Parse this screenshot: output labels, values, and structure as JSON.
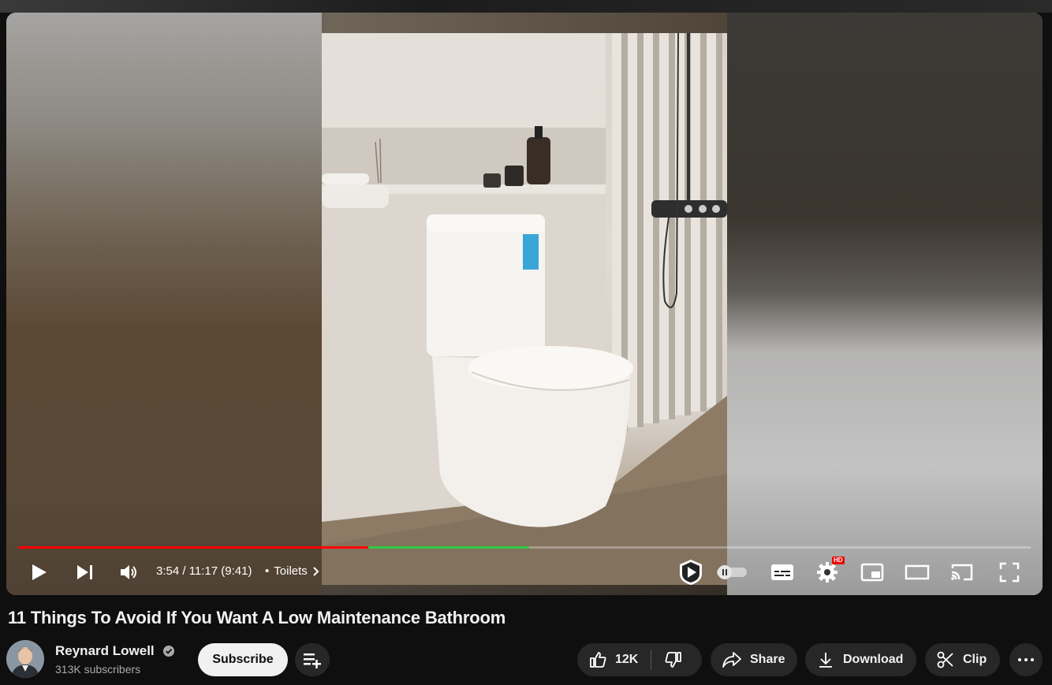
{
  "player": {
    "time_display": "3:54 / 11:17 (9:41)",
    "chapter_separator": "•",
    "chapter_title": "Toilets",
    "progress_fraction": 0.346,
    "buffered_fraction": 0.505,
    "quality_badge": "HD",
    "progress_color": "#ff0000",
    "buffer_color": "#2ecc40"
  },
  "video": {
    "title": "11 Things To Avoid If You Want A Low Maintenance Bathroom"
  },
  "channel": {
    "name": "Reynard Lowell",
    "subscribers": "313K subscribers",
    "subscribe_label": "Subscribe"
  },
  "actions": {
    "like_count": "12K",
    "share_label": "Share",
    "download_label": "Download",
    "clip_label": "Clip"
  },
  "icons": [
    "play-icon",
    "next-icon",
    "volume-icon",
    "chevron-right-icon",
    "sponsor-block-icon",
    "autoplay-toggle",
    "subtitles-icon",
    "settings-icon",
    "miniplayer-icon",
    "theater-icon",
    "cast-icon",
    "fullscreen-icon",
    "verified-icon",
    "add-to-playlist-icon",
    "like-icon",
    "dislike-icon",
    "share-icon",
    "download-icon",
    "clip-icon",
    "more-icon"
  ]
}
